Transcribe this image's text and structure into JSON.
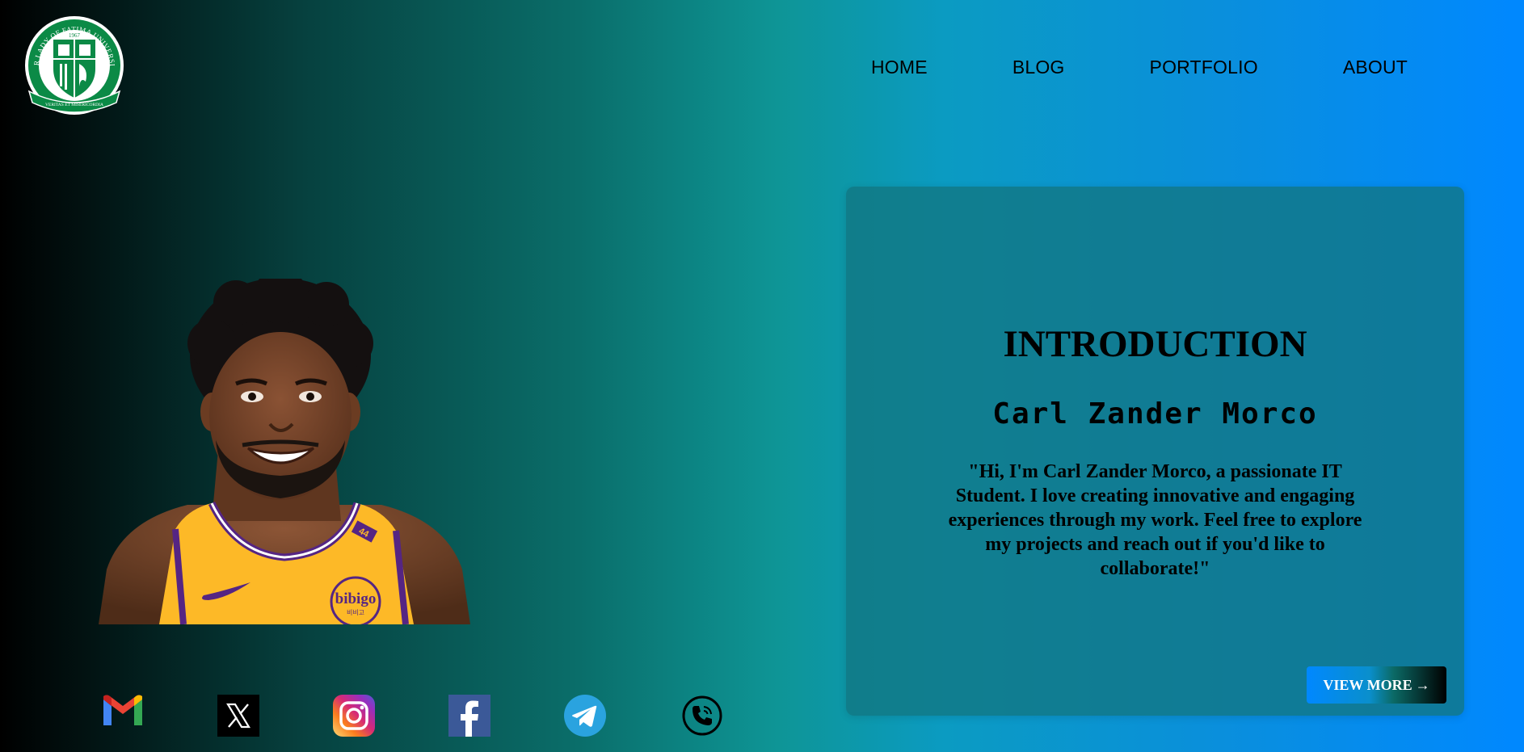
{
  "logo": {
    "top_arc_text": "OUR LADY OF FATIMA UNIVERSITY",
    "year": "1967",
    "ribbon_text": "VERITAS ET MISERICORDIA",
    "brand_color": "#0b8a46"
  },
  "nav": {
    "items": [
      {
        "label": "HOME"
      },
      {
        "label": "BLOG"
      },
      {
        "label": "PORTFOLIO"
      },
      {
        "label": "ABOUT"
      }
    ]
  },
  "portrait": {
    "jersey_number": "44",
    "sponsor": "bibigo",
    "sponsor_sub": "비비고",
    "jersey_color": "#fdb927",
    "trim_color": "#552583"
  },
  "intro": {
    "title": "INTRODUCTION",
    "name": "Carl Zander Morco",
    "text": "\"Hi, I'm Carl Zander Morco, a passionate IT Student. I love creating innovative and engaging experiences through my work. Feel free to explore my projects and reach out if you'd like to collaborate!\"",
    "button_label": "VIEW MORE",
    "button_arrow": "→"
  },
  "socials": [
    {
      "icon": "gmail-icon"
    },
    {
      "icon": "x-icon"
    },
    {
      "icon": "instagram-icon"
    },
    {
      "icon": "facebook-icon"
    },
    {
      "icon": "telegram-icon"
    },
    {
      "icon": "phone-icon"
    }
  ],
  "colors": {
    "gradient_start": "#000000",
    "gradient_mid": "#0e9596",
    "gradient_end": "#0088ff",
    "card_bg": "#127682"
  }
}
